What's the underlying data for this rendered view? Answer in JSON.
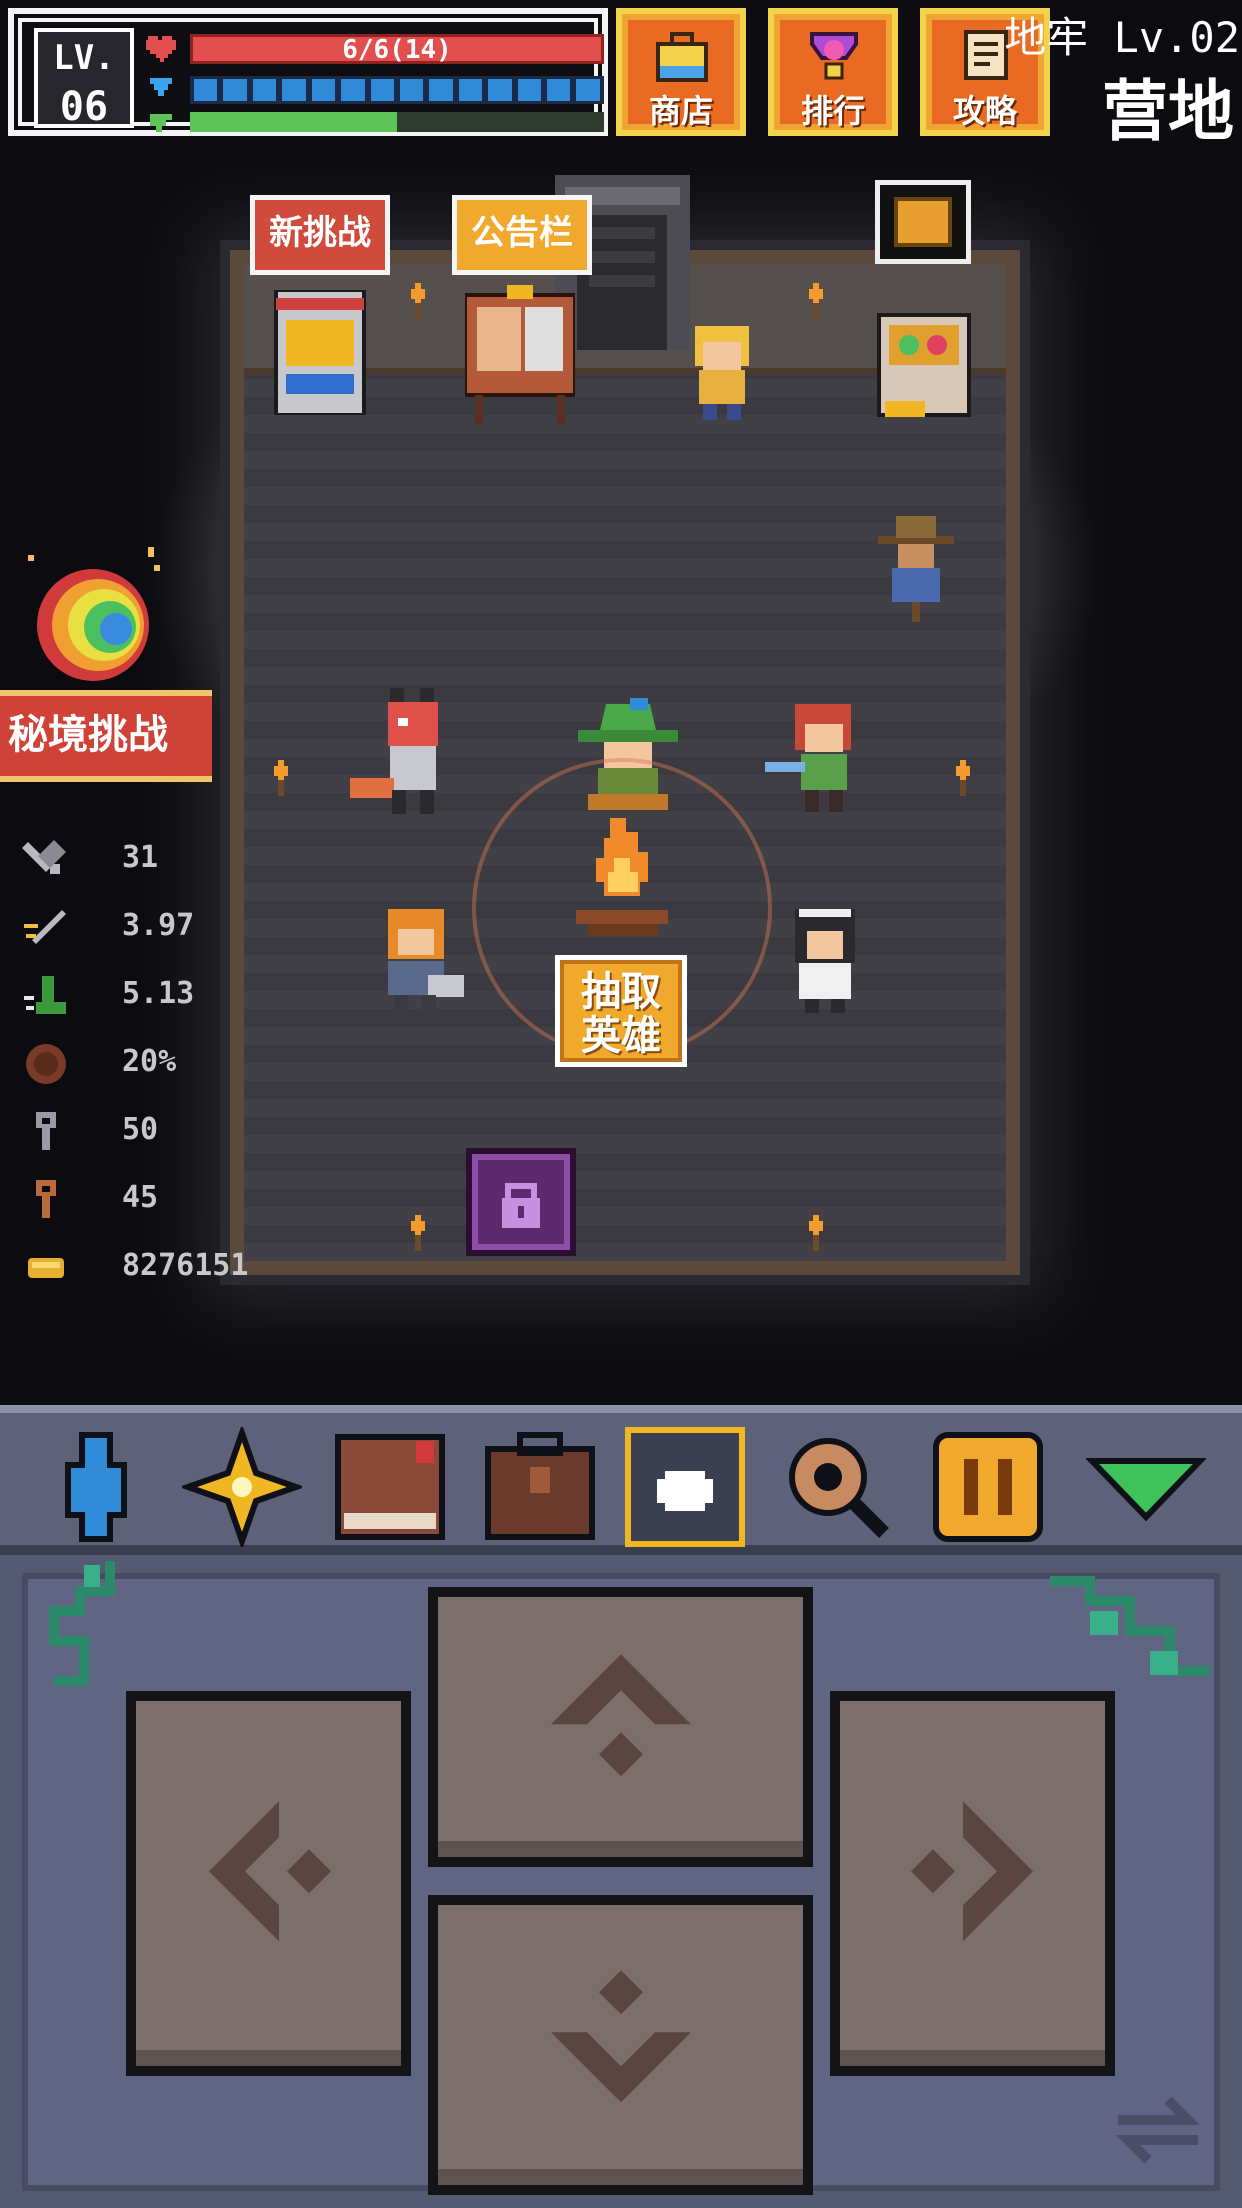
{
  "hud": {
    "lv_label": "LV.",
    "level": "06",
    "hp_text": "6/6(14)",
    "mana_segments": 14,
    "xp_progress": 0.5
  },
  "top_buttons": {
    "shop": "商店",
    "ranking": "排行",
    "guide": "攻略"
  },
  "location": {
    "dungeon_level": "地牢 Lv.02",
    "area": "营地"
  },
  "room": {
    "new_challenge": "新挑战",
    "bulletin_board": "公告栏",
    "summon_line1": "抽取",
    "summon_line2": "英雄"
  },
  "side": {
    "secret_challenge": "秘境挑战"
  },
  "stats": [
    {
      "icon": "sword-attack-icon",
      "value": "31"
    },
    {
      "icon": "sword-speed-icon",
      "value": "3.97"
    },
    {
      "icon": "boot-speed-icon",
      "value": "5.13"
    },
    {
      "icon": "shield-icon",
      "value": "20%"
    },
    {
      "icon": "silver-key-icon",
      "value": "50"
    },
    {
      "icon": "bronze-key-icon",
      "value": "45"
    },
    {
      "icon": "gold-coin-icon",
      "value": "8276151"
    }
  ],
  "toolbar": {
    "items": [
      "hero-silhouette-icon",
      "star-sparkle-icon",
      "book-icon",
      "backpack-icon",
      "target-fullscreen-icon",
      "magnifier-icon",
      "pause-icon",
      "dropdown-arrow-icon"
    ],
    "active": "target-fullscreen-icon"
  },
  "colors": {
    "accent_gold": "#f0b722",
    "hp_red": "#e24d4d",
    "mana_blue": "#2f8bd8",
    "xp_green": "#5cc456",
    "ribbon_red": "#cf4237"
  }
}
